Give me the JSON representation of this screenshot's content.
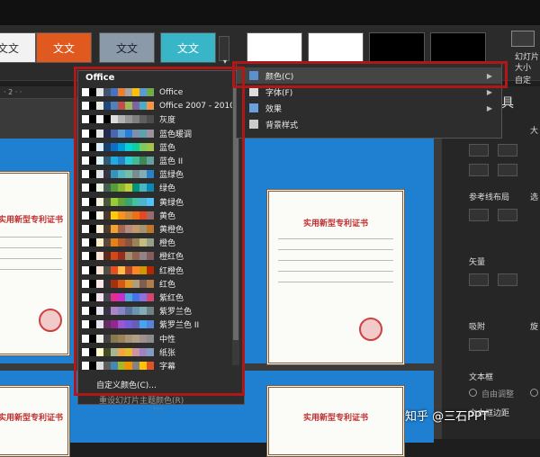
{
  "ribbon": {
    "themes": [
      {
        "label": "文文",
        "bg": "#f2f2f2",
        "fg": "#333"
      },
      {
        "label": "文文",
        "bg": "#e05a20",
        "fg": "#fff"
      },
      {
        "label": "文文",
        "bg": "#8a9aa8",
        "fg": "#223"
      },
      {
        "label": "文文",
        "bg": "#38b6c8",
        "fg": "#fff"
      }
    ],
    "variants": [
      {
        "bg": "#ffffff"
      },
      {
        "bg": "#ffffff"
      },
      {
        "bg": "#000000"
      },
      {
        "bg": "#000000"
      }
    ],
    "right_label_1": "幻灯片",
    "right_label_2": "大小",
    "right_label_3": "自定"
  },
  "color_menu": {
    "section_title": "Office",
    "items": [
      {
        "name": "Office",
        "colors": [
          "#ffffff",
          "#000000",
          "#e7e6e6",
          "#44546a",
          "#4472c4",
          "#ed7d31",
          "#a5a5a5",
          "#ffc000",
          "#5b9bd5",
          "#70ad47"
        ]
      },
      {
        "name": "Office 2007 - 2010",
        "colors": [
          "#ffffff",
          "#000000",
          "#eeece1",
          "#1f497d",
          "#4f81bd",
          "#c0504d",
          "#9bbb59",
          "#8064a2",
          "#4bacc6",
          "#f79646"
        ]
      },
      {
        "name": "灰度",
        "colors": [
          "#ffffff",
          "#000000",
          "#f8f8f8",
          "#000000",
          "#dddddd",
          "#b2b2b2",
          "#969696",
          "#808080",
          "#5f5f5f",
          "#4d4d4d"
        ]
      },
      {
        "name": "蓝色暖调",
        "colors": [
          "#ffffff",
          "#000000",
          "#e7e6e6",
          "#242852",
          "#4a66ac",
          "#629dd1",
          "#297fd5",
          "#7f8fa9",
          "#5aa2ae",
          "#9d90a0"
        ]
      },
      {
        "name": "蓝色",
        "colors": [
          "#ffffff",
          "#000000",
          "#dbefff",
          "#17406d",
          "#0f6fc6",
          "#009dd9",
          "#0bd0d9",
          "#10cf9b",
          "#7cca62",
          "#a5c249"
        ]
      },
      {
        "name": "蓝色 II",
        "colors": [
          "#ffffff",
          "#000000",
          "#dbf5f9",
          "#335b74",
          "#1cade4",
          "#2683c6",
          "#27ced7",
          "#42ba97",
          "#3e8853",
          "#62a39f"
        ]
      },
      {
        "name": "蓝绿色",
        "colors": [
          "#ffffff",
          "#000000",
          "#dee6e8",
          "#373545",
          "#3494ba",
          "#58b6c0",
          "#75bda7",
          "#7a8c8e",
          "#84acb6",
          "#2683c6"
        ]
      },
      {
        "name": "绿色",
        "colors": [
          "#ffffff",
          "#000000",
          "#ebf6e5",
          "#455f51",
          "#549e39",
          "#8ab833",
          "#c0cf3a",
          "#029676",
          "#4ab5c4",
          "#0989b1"
        ]
      },
      {
        "name": "黄绿色",
        "colors": [
          "#ffffff",
          "#000000",
          "#f3f3e0",
          "#4a5a3c",
          "#99cb38",
          "#63a537",
          "#37a76f",
          "#44c1a3",
          "#4eb3cf",
          "#51c3f9"
        ]
      },
      {
        "name": "黄色",
        "colors": [
          "#ffffff",
          "#000000",
          "#fffbe6",
          "#4e3b30",
          "#ffca08",
          "#f8931d",
          "#ce8d3e",
          "#ec7016",
          "#e64823",
          "#9c6a6a"
        ]
      },
      {
        "name": "黄橙色",
        "colors": [
          "#ffffff",
          "#000000",
          "#fff5db",
          "#4e3b30",
          "#f0a22e",
          "#a5644e",
          "#b58b80",
          "#c3986d",
          "#a19574",
          "#c17529"
        ]
      },
      {
        "name": "橙色",
        "colors": [
          "#ffffff",
          "#000000",
          "#fbeec9",
          "#5c4a3c",
          "#e48312",
          "#bd582c",
          "#865640",
          "#9b8357",
          "#c2bc80",
          "#94a088"
        ]
      },
      {
        "name": "橙红色",
        "colors": [
          "#ffffff",
          "#000000",
          "#fbe4d5",
          "#5e2a1c",
          "#d34817",
          "#9b2d1f",
          "#a28e6a",
          "#956251",
          "#918485",
          "#855d5d"
        ]
      },
      {
        "name": "红橙色",
        "colors": [
          "#ffffff",
          "#000000",
          "#fbe5d6",
          "#505046",
          "#e84c22",
          "#ffbd47",
          "#b64926",
          "#ff8427",
          "#cc9900",
          "#b22600"
        ]
      },
      {
        "name": "红色",
        "colors": [
          "#ffffff",
          "#000000",
          "#f7e9e8",
          "#323232",
          "#a5300f",
          "#d55816",
          "#e19825",
          "#b19c7d",
          "#7f5f52",
          "#b27d49"
        ]
      },
      {
        "name": "紫红色",
        "colors": [
          "#ffffff",
          "#000000",
          "#f5e3ef",
          "#454551",
          "#e32d91",
          "#c830cc",
          "#4ea6dc",
          "#4775e7",
          "#8971e1",
          "#d54773"
        ]
      },
      {
        "name": "紫罗兰色",
        "colors": [
          "#ffffff",
          "#000000",
          "#ece5f4",
          "#373545",
          "#ad84c6",
          "#8784c7",
          "#5d739a",
          "#6997af",
          "#84acb6",
          "#6f8183"
        ]
      },
      {
        "name": "紫罗兰色 II",
        "colors": [
          "#ffffff",
          "#000000",
          "#e7e1f0",
          "#632e62",
          "#92278f",
          "#9b57d3",
          "#755dd9",
          "#665eb8",
          "#45a5ed",
          "#5982db"
        ]
      },
      {
        "name": "中性",
        "colors": [
          "#ffffff",
          "#000000",
          "#f0eee8",
          "#424242",
          "#8a784f",
          "#9b8357",
          "#a79577",
          "#b29e85",
          "#a0918f",
          "#8c8c8c"
        ]
      },
      {
        "name": "纸张",
        "colors": [
          "#ffffff",
          "#000000",
          "#fefac9",
          "#444d26",
          "#a5b592",
          "#f3a447",
          "#e7bc29",
          "#d092a7",
          "#9c85c0",
          "#809ec2"
        ]
      },
      {
        "name": "字幕",
        "colors": [
          "#ffffff",
          "#000000",
          "#ddddde",
          "#5e5e5e",
          "#418ab3",
          "#a6b727",
          "#f69200",
          "#838383",
          "#fec306",
          "#df5327"
        ]
      }
    ],
    "custom_label": "自定义颜色(C)...",
    "reset_label": "重设幻灯片主题颜色(R)"
  },
  "submenu": {
    "items": [
      {
        "label": "颜色(C)",
        "icon": "color-palette-icon"
      },
      {
        "label": "字体(F)",
        "icon": "font-icon"
      },
      {
        "label": "效果",
        "icon": "effects-icon"
      },
      {
        "label": "背景样式",
        "icon": "background-icon"
      }
    ]
  },
  "canvas": {
    "slide_bg": "#1f7fd1",
    "cert_title": "实用新型专利证书"
  },
  "right_panel": {
    "tools_label": "具",
    "ref_lines": "参考线布局",
    "vector": "矢量",
    "snap": "吸附",
    "textbox": "文本框",
    "autofit": "自由调整",
    "textbox_margin": "文本框边距",
    "big": "大",
    "sel": "选",
    "rot": "旋"
  },
  "watermark": "知乎 @三石PPT",
  "highlight_color": "#b01818"
}
